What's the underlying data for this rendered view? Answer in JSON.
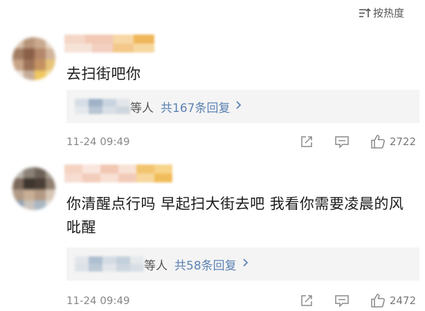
{
  "sort": {
    "label": "按热度"
  },
  "comments": [
    {
      "text": "去扫街吧你",
      "reply_suffix": "等人",
      "reply_count": "共167条回复",
      "time": "11-24 09:49",
      "likes": "2722"
    },
    {
      "text": "你清醒点行吗 早起扫大街去吧 我看你需要凌晨的风吡醒",
      "reply_suffix": "等人",
      "reply_count": "共58条回复",
      "time": "11-24 09:49",
      "likes": "2472"
    }
  ],
  "icons": {
    "sort": "sort-icon",
    "share": "share-icon",
    "reply": "comment-icon",
    "like": "thumbs-up-icon",
    "chevron": "chevron-right-icon"
  },
  "colors": {
    "link": "#5b82b3",
    "reply_bg": "#f4f4f4",
    "meta": "#888888"
  }
}
